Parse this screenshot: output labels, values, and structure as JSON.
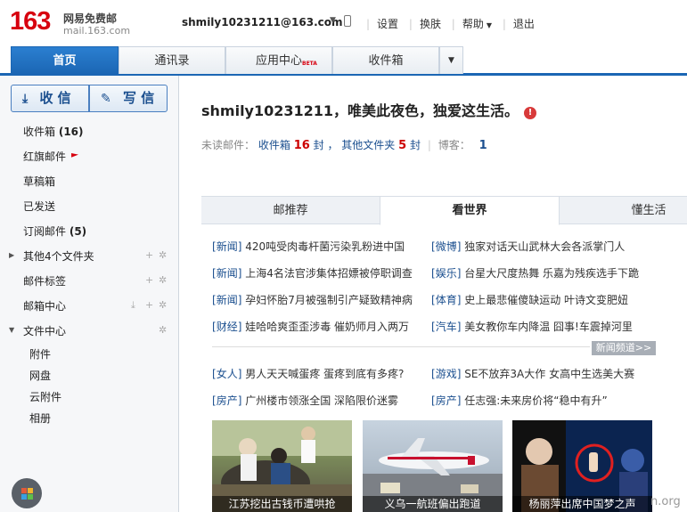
{
  "logo": {
    "num": "163",
    "title": "网易免费邮",
    "domain": "mail.163.com"
  },
  "account": {
    "email": "shmily10231211@163.com"
  },
  "top_links": [
    "设置",
    "换肤",
    "帮助",
    "退出"
  ],
  "tabs": [
    "首页",
    "通讯录",
    "应用中心",
    "收件箱"
  ],
  "beta": "BETA",
  "sidebar": {
    "receive": "收 信",
    "write": "写 信",
    "items": [
      {
        "label": "收件箱",
        "count": "(16)"
      },
      {
        "label": "红旗邮件",
        "count": ""
      },
      {
        "label": "草稿箱",
        "count": ""
      },
      {
        "label": "已发送",
        "count": ""
      },
      {
        "label": "订阅邮件",
        "count": "(5)"
      },
      {
        "label": "其他4个文件夹",
        "count": ""
      },
      {
        "label": "邮件标签",
        "count": ""
      },
      {
        "label": "邮箱中心",
        "count": ""
      },
      {
        "label": "文件中心",
        "count": ""
      }
    ],
    "sub_items": [
      "附件",
      "网盘",
      "云附件",
      "相册"
    ]
  },
  "main": {
    "greeting": "shmily10231211，唯美此夜色，独爱这生活。",
    "unread_label": "未读邮件：",
    "inbox_label": "收件箱",
    "inbox_count": "16",
    "unit": "封",
    "comma": "，",
    "other_label": "其他文件夹",
    "other_count": "5",
    "blog_label": "博客：",
    "blog_count": "1"
  },
  "news_tabs": [
    "邮推荐",
    "看世界",
    "懂生活"
  ],
  "news": [
    {
      "cat": "新闻",
      "text": "420吨受肉毒杆菌污染乳粉进中国"
    },
    {
      "cat": "微博",
      "text": "独家对话天山武林大会各派掌门人"
    },
    {
      "cat": "新闻",
      "text": "上海4名法官涉集体招嫖被停职调查"
    },
    {
      "cat": "娱乐",
      "text": "台星大尺度热舞 乐嘉为残疾选手下跪"
    },
    {
      "cat": "新闻",
      "text": "孕妇怀胎7月被强制引产疑致精神病"
    },
    {
      "cat": "体育",
      "text": "史上最悲催傻缺运动 叶诗文变肥妞"
    },
    {
      "cat": "财经",
      "text": "娃哈哈爽歪歪涉毒 催奶师月入两万"
    },
    {
      "cat": "汽车",
      "text": "美女教你车内降温 囧事!车震掉河里"
    },
    {
      "cat": "女人",
      "text": "男人天天喊蛋疼 蛋疼到底有多疼?"
    },
    {
      "cat": "游戏",
      "text": "SE不放弃3A大作 女高中生选美大赛"
    },
    {
      "cat": "房产",
      "text": "广州楼市领涨全国 深陷限价迷雾"
    },
    {
      "cat": "房产",
      "text": "任志强:未来房价将“稳中有升”"
    }
  ],
  "more_label": "新闻频道>>",
  "thumbs": [
    "江苏挖出古钱币遭哄抢",
    "义乌一航班偏出跑道",
    "杨丽萍出席中国梦之声"
  ],
  "watermark": "n.org"
}
